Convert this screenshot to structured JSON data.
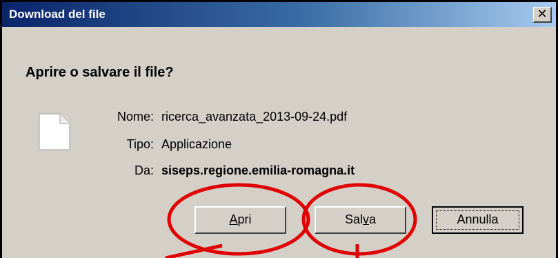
{
  "window": {
    "title": "Download del file",
    "close_glyph": "✕"
  },
  "dialog": {
    "heading": "Aprire o salvare il file?",
    "file_icon": "document-icon",
    "fields": [
      {
        "label": "Nome:",
        "value": "ricerca_avanzata_2013-09-24.pdf"
      },
      {
        "label": "Tipo:",
        "value": "Applicazione"
      },
      {
        "label": "Da:",
        "value": "siseps.regione.emilia-romagna.it"
      }
    ]
  },
  "buttons": {
    "open": {
      "pre": "",
      "mnemonic": "A",
      "post": "pri"
    },
    "save": {
      "pre": "Sal",
      "mnemonic": "v",
      "post": "a"
    },
    "cancel": {
      "label": "Annulla"
    }
  },
  "annotation": {
    "color": "#e00000",
    "shape": "ellipses-with-arrows"
  }
}
